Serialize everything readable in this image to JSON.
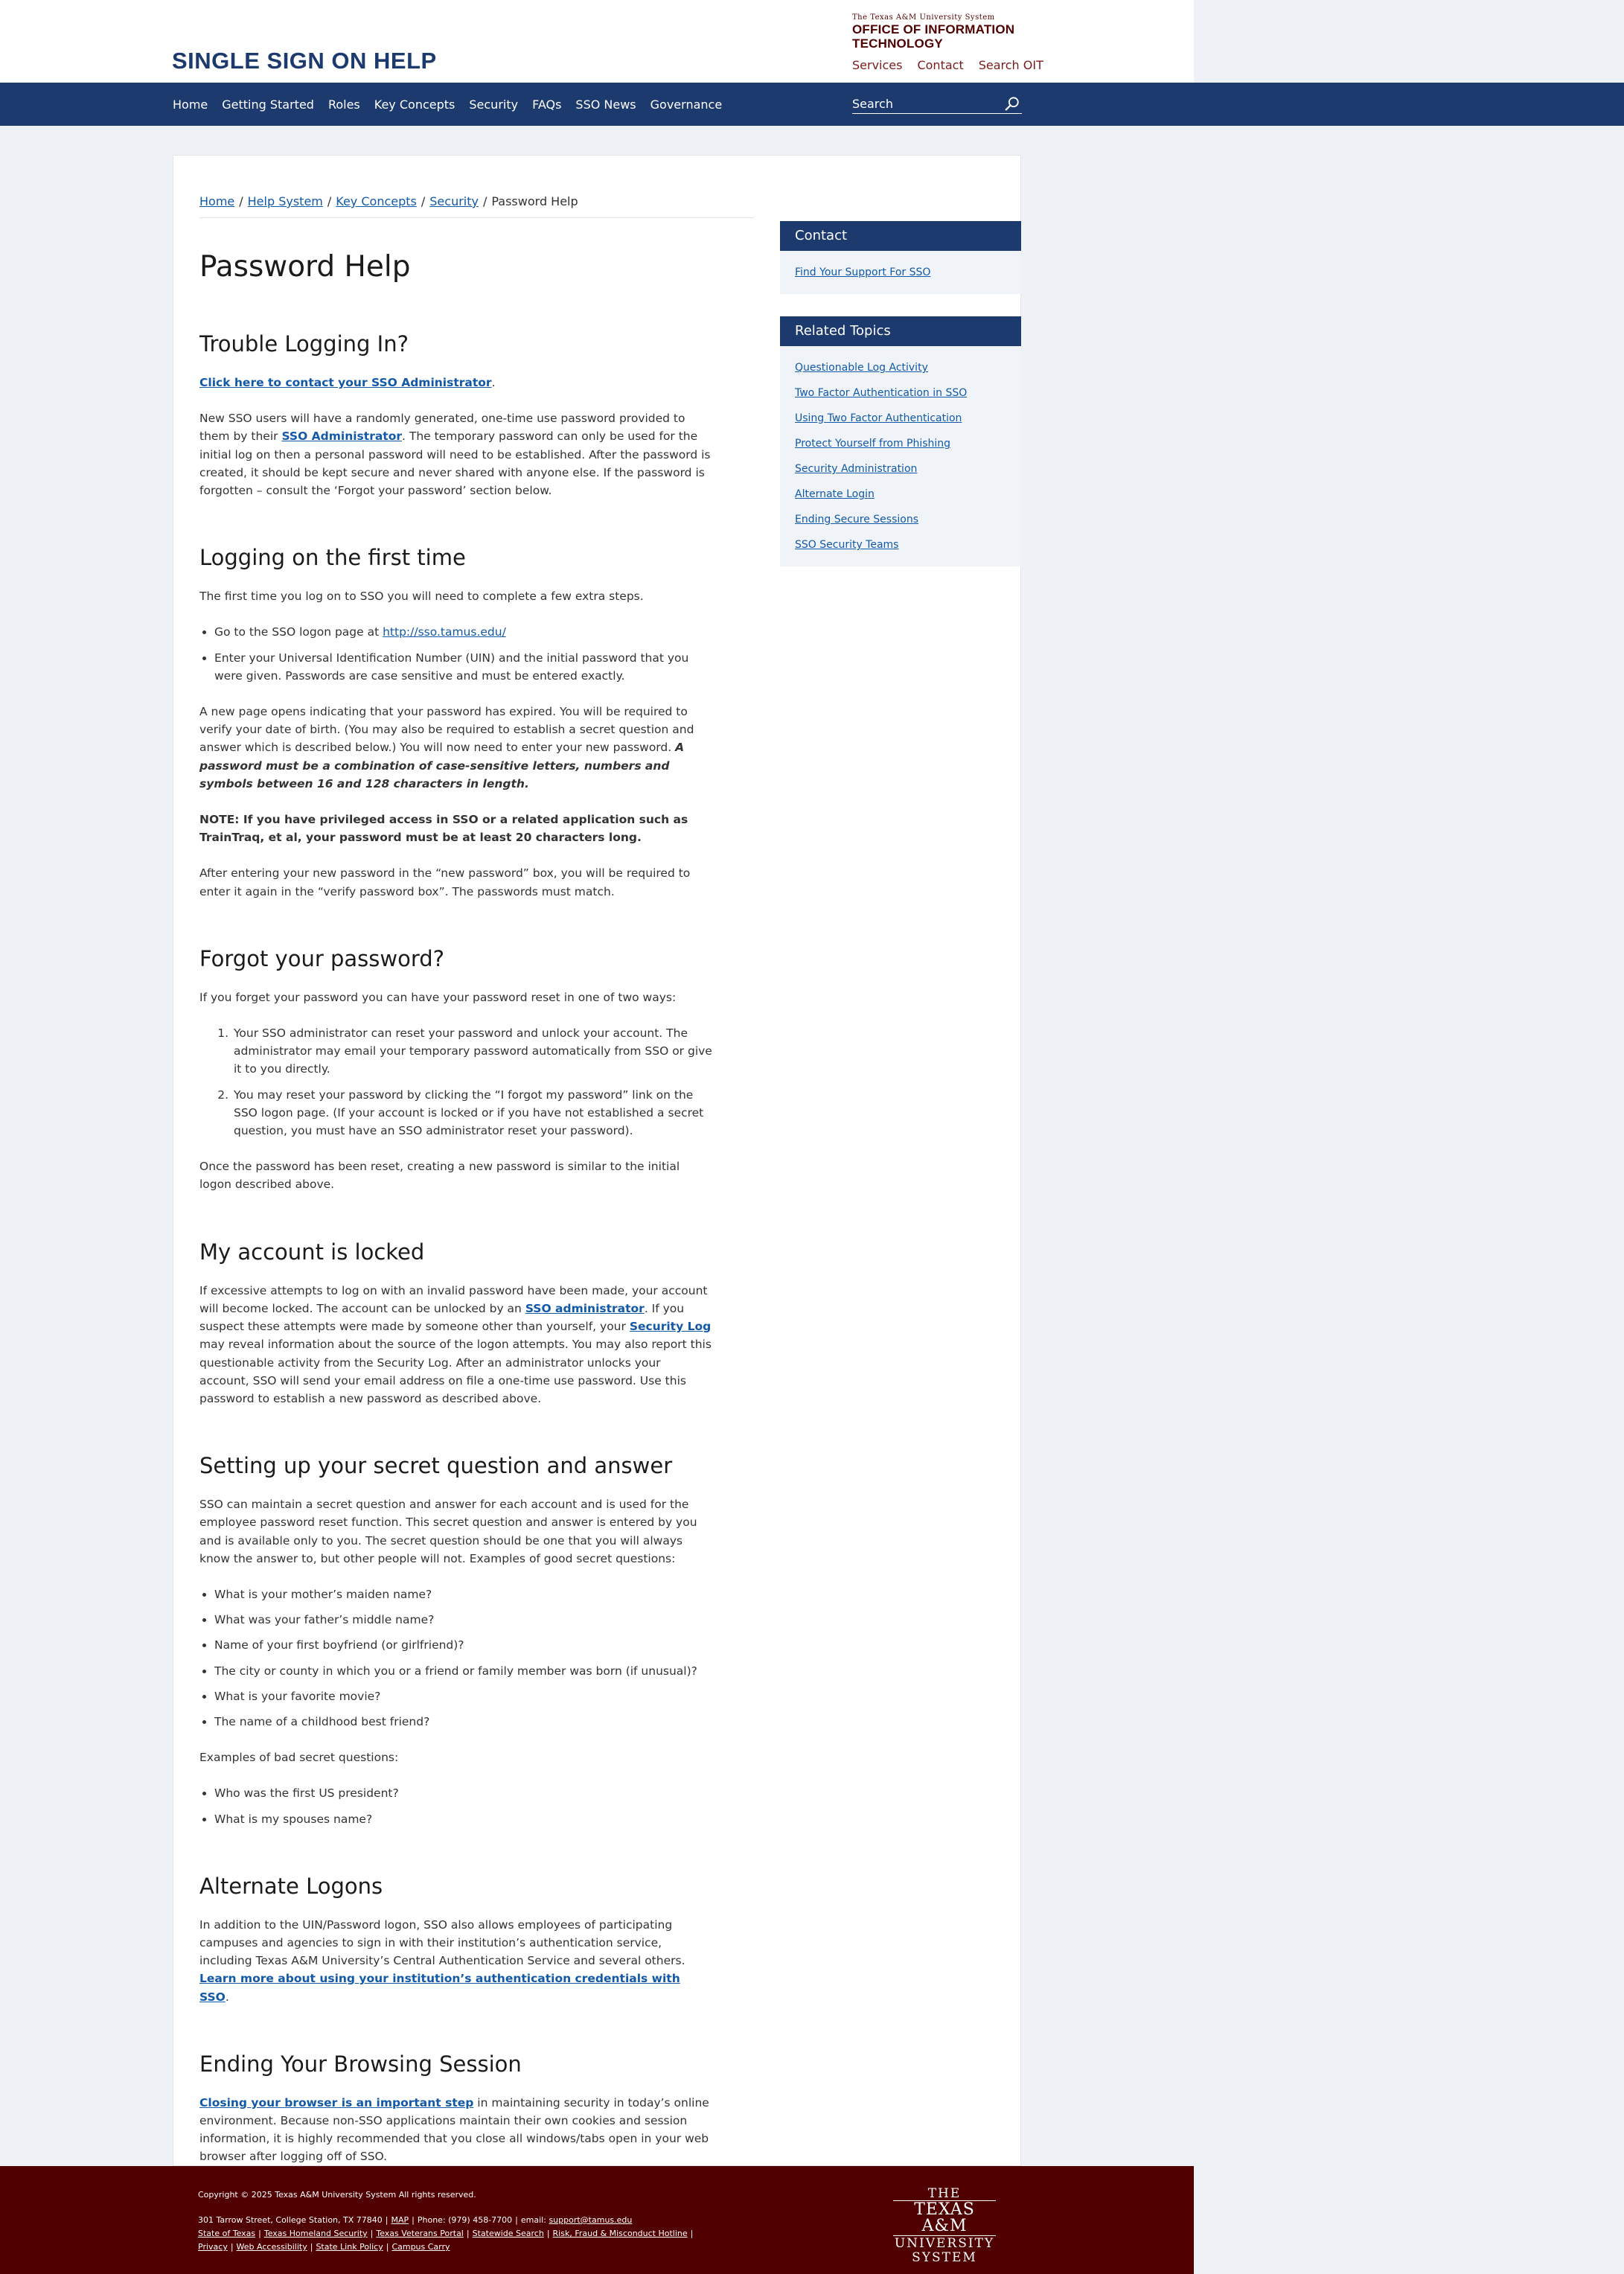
{
  "header": {
    "site_title": "SINGLE SIGN ON HELP",
    "logo_line1": "The Texas A&M University System",
    "logo_line2": "OFFICE OF INFORMATION",
    "logo_line3": "TECHNOLOGY",
    "links": [
      "Services",
      "Contact",
      "Search OIT"
    ]
  },
  "nav": {
    "items": [
      "Home",
      "Getting Started",
      "Roles",
      "Key Concepts",
      "Security",
      "FAQs",
      "SSO News",
      "Governance"
    ],
    "search_placeholder": "Search"
  },
  "breadcrumb": {
    "links": [
      "Home",
      "Help System",
      "Key Concepts",
      "Security"
    ],
    "separator": "/",
    "current": "Password Help"
  },
  "page": {
    "title": "Password Help",
    "sections": {
      "trouble": {
        "heading": "Trouble Logging In?",
        "contact_link": "Click here to contact your SSO Administrator",
        "contact_tail": ".",
        "p1_pre": "New SSO users will have a randomly generated, one-time use password provided to them by their ",
        "p1_link": "SSO Administrator",
        "p1_post": ". The temporary password can only be used for the initial log on then a personal password will need to be established.  After the password is created, it should be kept secure and never shared with anyone else. If the password is forgotten – consult the ‘Forgot your password’ section below."
      },
      "first_time": {
        "heading": "Logging on the first time",
        "intro": "The first time you log on to SSO you will need to complete a few extra steps.",
        "bullet1_pre": "Go to the SSO logon page at ",
        "bullet1_link": "http://sso.tamus.edu/",
        "bullet2": "Enter your Universal Identification Number (UIN) and the initial password that you were given.  Passwords are case sensitive and must be entered exactly.",
        "p2_pre": "A new page opens indicating that your password has expired.  You will be required to verify your date of birth. (You may also be required to establish a secret question and answer which is described below.) You will now need to enter your new password. ",
        "p2_emph": "A password must be a combination of case-sensitive letters, numbers and symbols between 16 and 128 characters in length.",
        "note": "NOTE: If you have privileged access in SSO or a related application such as TrainTraq, et al, your password must be at least 20 characters long.",
        "p3": "After entering your new password in the “new password” box, you will be required to enter it again in the “verify password box”. The passwords must match."
      },
      "forgot": {
        "heading": "Forgot your password?",
        "intro": "If you forget your password you can have your password reset in one of two ways:",
        "items": [
          "Your SSO administrator can reset your password and unlock your account.  The administrator may email your temporary password automatically from SSO or give it to you directly.",
          "You may reset your password by clicking the “I forgot my password” link on the SSO logon page. (If your account is locked or if you have not established a secret question, you must have an SSO administrator reset your password)."
        ],
        "outro": "Once the password has been reset, creating a new password is  similar to the initial logon described above."
      },
      "locked": {
        "heading": "My account is locked",
        "p_pre": "If excessive attempts to log on with an invalid password have been made, your account will become locked.  The account can be unlocked by an ",
        "p_link1": "SSO administrator",
        "p_mid": ".  If you suspect these attempts were made by someone other than yourself, your ",
        "p_link2": "Security Log",
        "p_post": " may reveal information about the source of the logon attempts. You may also report this questionable activity from the Security Log. After an administrator unlocks your account, SSO will send your email address on file a one-time use password.  Use this password to establish a new password as described above."
      },
      "secret": {
        "heading": "Setting up your secret question and answer",
        "intro": "SSO can maintain a secret question and answer for each account and is used for the employee password reset function.  This secret question and answer is entered by you and is available only to you. The secret question should be one that you will always know the answer to, but other people will not. Examples of good secret questions:",
        "good": [
          "What is your mother’s maiden name?",
          "What was your father’s middle name?",
          "Name of your first boyfriend (or girlfriend)?",
          "The city or county in which you or a friend or family member was born (if unusual)?",
          "What is your favorite movie?",
          "The name of a childhood best friend?"
        ],
        "bad_intro": "Examples of bad secret questions:",
        "bad": [
          "Who was the first US president?",
          "What is my spouses name?"
        ]
      },
      "alternate": {
        "heading": "Alternate Logons",
        "p_pre": "In addition to the UIN/Password logon, SSO also allows employees of participating campuses and agencies to sign in with their institution’s authentication service, including Texas A&M University’s Central Authentication Service and several others. ",
        "p_link": "Learn more about using your institution’s authentication credentials with SSO",
        "p_post": "."
      },
      "ending": {
        "heading": "Ending Your Browsing Session",
        "p_link": "Closing your browser is an important step",
        "p_post": " in maintaining security in today’s online environment. Because non-SSO applications maintain their own cookies and session information, it is highly recommended that you close all windows/tabs open in your web browser after logging off of SSO."
      }
    }
  },
  "sidebar": {
    "contact": {
      "heading": "Contact",
      "links": [
        "Find Your Support For SSO"
      ]
    },
    "related": {
      "heading": "Related Topics",
      "links": [
        "Questionable Log Activity",
        "Two Factor Authentication in SSO",
        "Using Two Factor Authentication",
        "Protect Yourself from Phishing",
        "Security Administration",
        "Alternate Login",
        "Ending Secure Sessions",
        "SSO Security Teams"
      ]
    }
  },
  "footer": {
    "copyright": "Copyright © 2025 Texas A&M University System All rights reserved.",
    "address": "301 Tarrow Street, College Station, TX 77840",
    "map": "MAP",
    "phone": "Phone: (979) 458-7700",
    "email_label": "email:",
    "email": "support@tamus.edu",
    "links_row2": [
      "State of Texas",
      "Texas Homeland Security",
      "Texas Veterans Portal",
      "Statewide Search",
      "Risk, Fraud & Misconduct Hotline"
    ],
    "links_row3": [
      "Privacy",
      "Web Accessibility",
      "State Link Policy",
      "Campus Carry"
    ],
    "logo": [
      "THE",
      "TEXAS A&M",
      "UNIVERSITY",
      "SYSTEM"
    ]
  },
  "colors": {
    "nav_blue": "#1c3a6e",
    "maroon": "#500000",
    "link": "#1259a8",
    "page_bg": "#eef2f6"
  }
}
